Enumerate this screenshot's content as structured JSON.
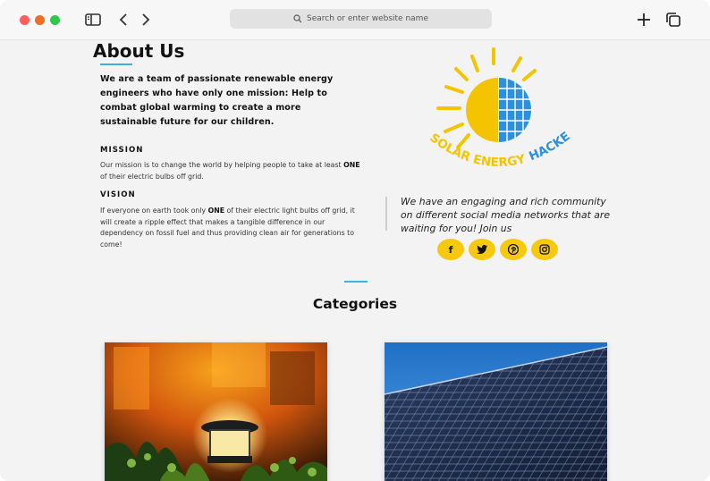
{
  "browser": {
    "url_placeholder": "Search or enter website name"
  },
  "about": {
    "title": "About Us",
    "intro": "We are a team of passionate renewable energy engineers who have only one mission: Help to combat global warming to create a more sustainable future for our children.",
    "mission_heading": "MISSION",
    "mission_text_pre": "Our mission is to change the world by helping people to take at least ",
    "mission_text_bold": "ONE",
    "mission_text_post": " of their electric bulbs off grid.",
    "vision_heading": "VISION",
    "vision_text_pre": "If everyone on earth took only ",
    "vision_text_bold": "ONE",
    "vision_text_post": " of their electric light bulbs off grid, it will create a ripple effect that makes a tangible difference in our dependency on fossil fuel and thus providing clean air for generations to come!"
  },
  "logo": {
    "text_yellow": "SOLAR ENERGY",
    "text_blue": "HACKERS",
    "yellow": "#f5c400",
    "blue": "#2d8fe0"
  },
  "community": {
    "text": "We have an engaging and rich community on different social media networks that are waiting for you! Join us"
  },
  "socials": [
    {
      "name": "facebook",
      "glyph": "f"
    },
    {
      "name": "twitter",
      "glyph": "t"
    },
    {
      "name": "pinterest",
      "glyph": "p"
    },
    {
      "name": "instagram",
      "glyph": "◎"
    }
  ],
  "categories": {
    "title": "Categories"
  },
  "colors": {
    "accent": "#3ab2e6",
    "social_bg": "#f6c90e"
  }
}
